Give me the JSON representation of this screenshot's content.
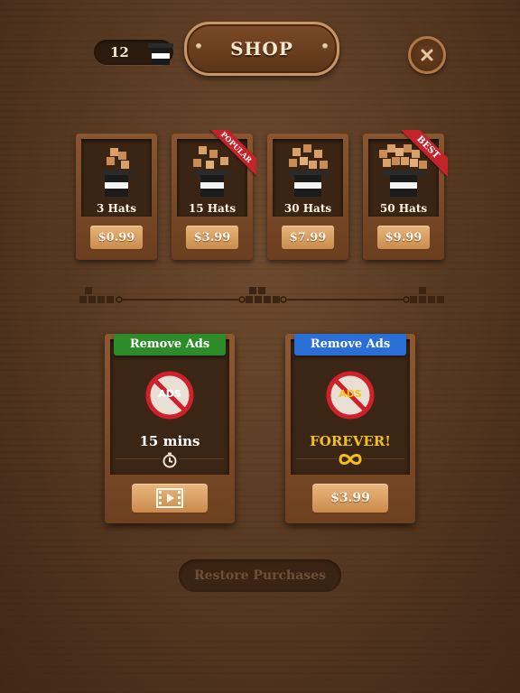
{
  "header": {
    "hat_count": "12",
    "title": "SHOP"
  },
  "packs": [
    {
      "label": "3 Hats",
      "price": "$0.99",
      "ribbon": ""
    },
    {
      "label": "15 Hats",
      "price": "$3.99",
      "ribbon": "POPULAR"
    },
    {
      "label": "30 Hats",
      "price": "$7.99",
      "ribbon": ""
    },
    {
      "label": "50 Hats",
      "price": "$9.99",
      "ribbon": "BEST"
    }
  ],
  "remove_ads": [
    {
      "banner": "Remove Ads",
      "badge": "ADS",
      "duration": "15 mins",
      "banner_color": "#2e8b2a",
      "duration_color": "#ffffff",
      "sub_icon": "timer-icon",
      "action_icon": "video-icon"
    },
    {
      "banner": "Remove Ads",
      "badge": "ADS",
      "duration": "FOREVER!",
      "banner_color": "#2a6fd6",
      "duration_color": "#f2c21a",
      "sub_icon": "infinity-icon",
      "action_label": "$3.99"
    }
  ],
  "restore_label": "Restore Purchases",
  "colors": {
    "accent_red": "#c3232b",
    "price_button": "#d99c5e",
    "wood": "#7a4a26"
  }
}
